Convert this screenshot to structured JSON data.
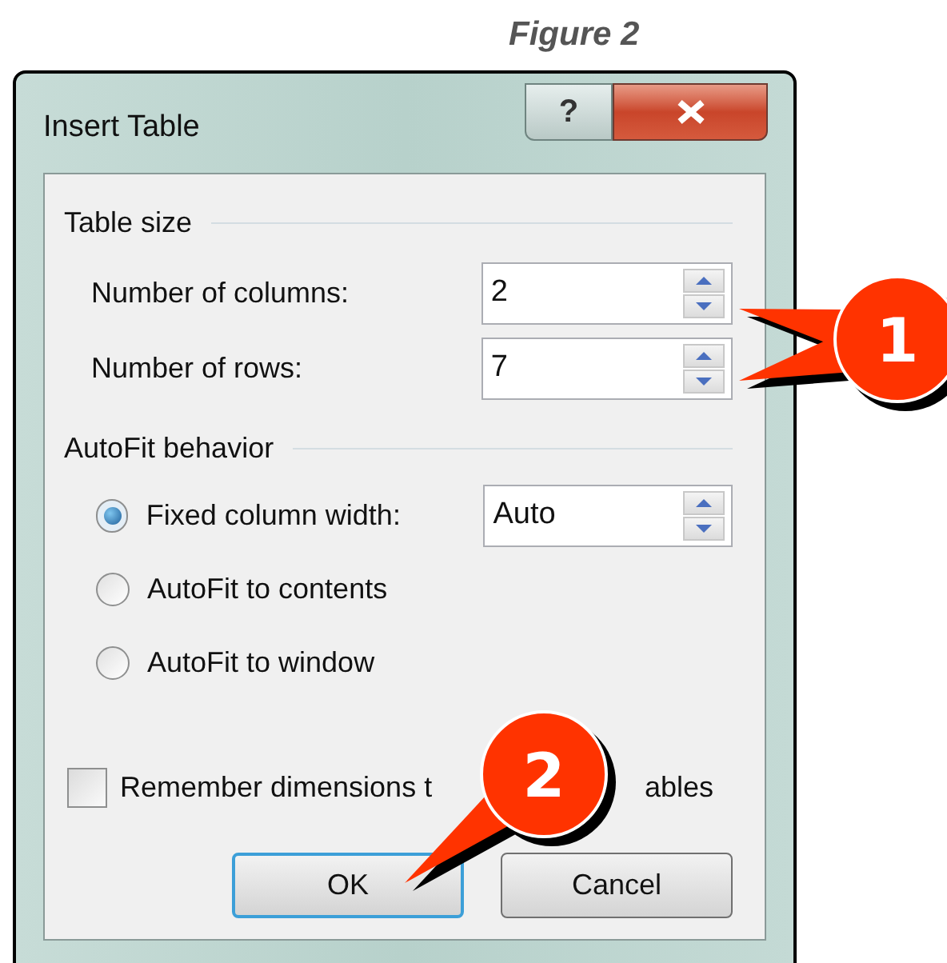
{
  "caption": "Figure 2",
  "window": {
    "title": "Insert Table",
    "help_button": "?"
  },
  "sections": [
    {
      "title": "Table size",
      "rows": [
        {
          "kind": "spinner",
          "label": "Number of columns:",
          "value": "2"
        },
        {
          "kind": "spinner",
          "label": "Number of rows:",
          "value": "7"
        }
      ]
    },
    {
      "title": "AutoFit behavior",
      "rows": [
        {
          "kind": "radio",
          "label": "Fixed column width:",
          "selected": true,
          "value": "Auto"
        },
        {
          "kind": "radio",
          "label": "AutoFit to contents",
          "selected": false
        },
        {
          "kind": "radio",
          "label": "AutoFit to window",
          "selected": false
        }
      ]
    }
  ],
  "checkbox": {
    "label_start": "Remember dimensions t",
    "label_end": "ables",
    "checked": false
  },
  "buttons": [
    {
      "label": "OK",
      "default": true
    },
    {
      "label": "Cancel",
      "default": false
    }
  ],
  "callouts": [
    {
      "number": "1"
    },
    {
      "number": "2"
    }
  ]
}
